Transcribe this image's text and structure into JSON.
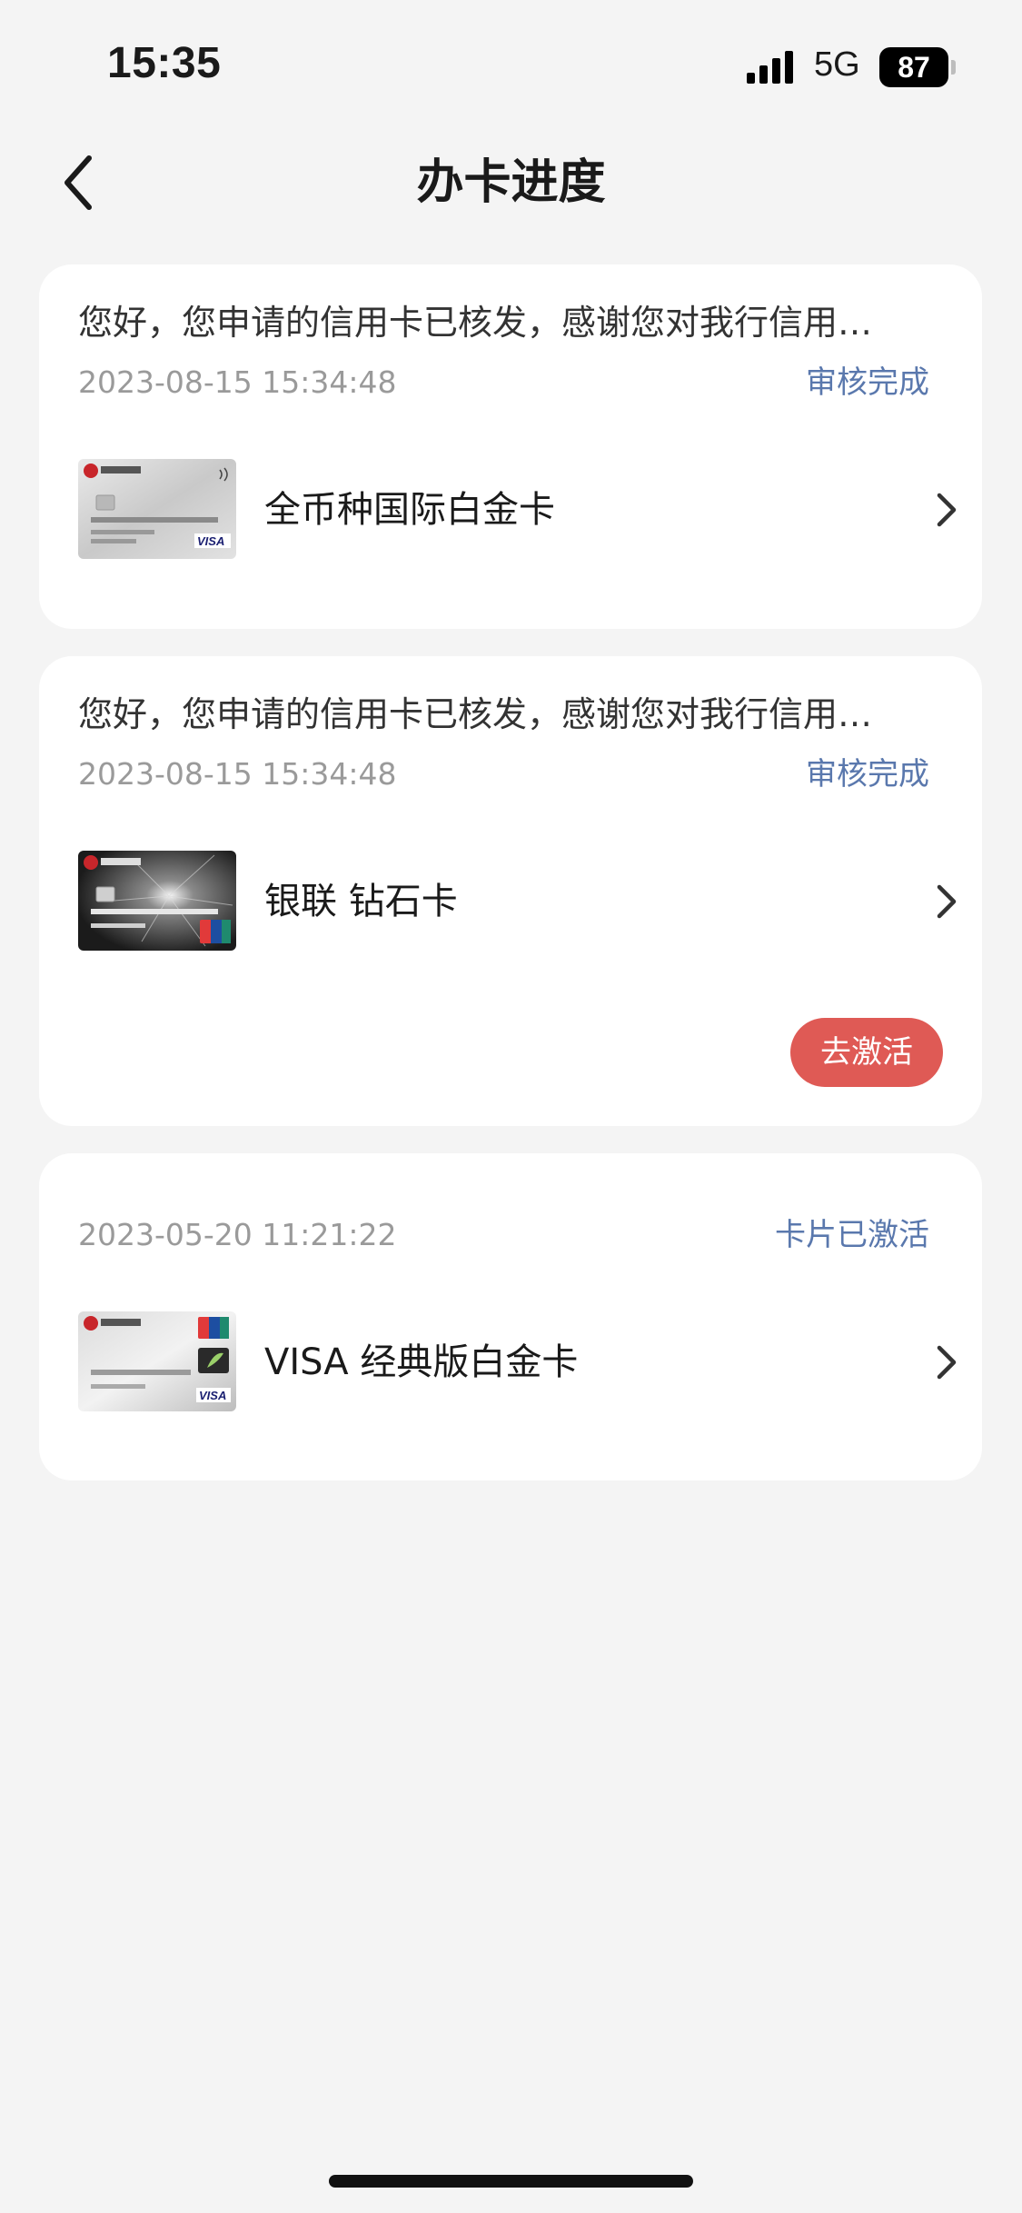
{
  "status_bar": {
    "time": "15:35",
    "network": "5G",
    "battery": "87"
  },
  "header": {
    "title": "办卡进度",
    "back_icon": "chevron-left-icon"
  },
  "applications": [
    {
      "message": "您好，您申请的信用卡已核发，感谢您对我行信用…",
      "timestamp": "2023-08-15 15:34:48",
      "status": "审核完成",
      "card_name": "全币种国际白金卡",
      "card_style": "silver-visa",
      "status_color": "#5a78ad"
    },
    {
      "message": "您好，您申请的信用卡已核发，感谢您对我行信用…",
      "timestamp": "2023-08-15 15:34:48",
      "status": "审核完成",
      "card_name": "银联 钻石卡",
      "card_style": "black-unionpay",
      "action_label": "去激活",
      "action_color": "#df5a55"
    },
    {
      "timestamp": "2023-05-20 11:21:22",
      "status": "卡片已激活",
      "card_name": "VISA 经典版白金卡",
      "card_style": "silver-unionpay-visa"
    }
  ]
}
